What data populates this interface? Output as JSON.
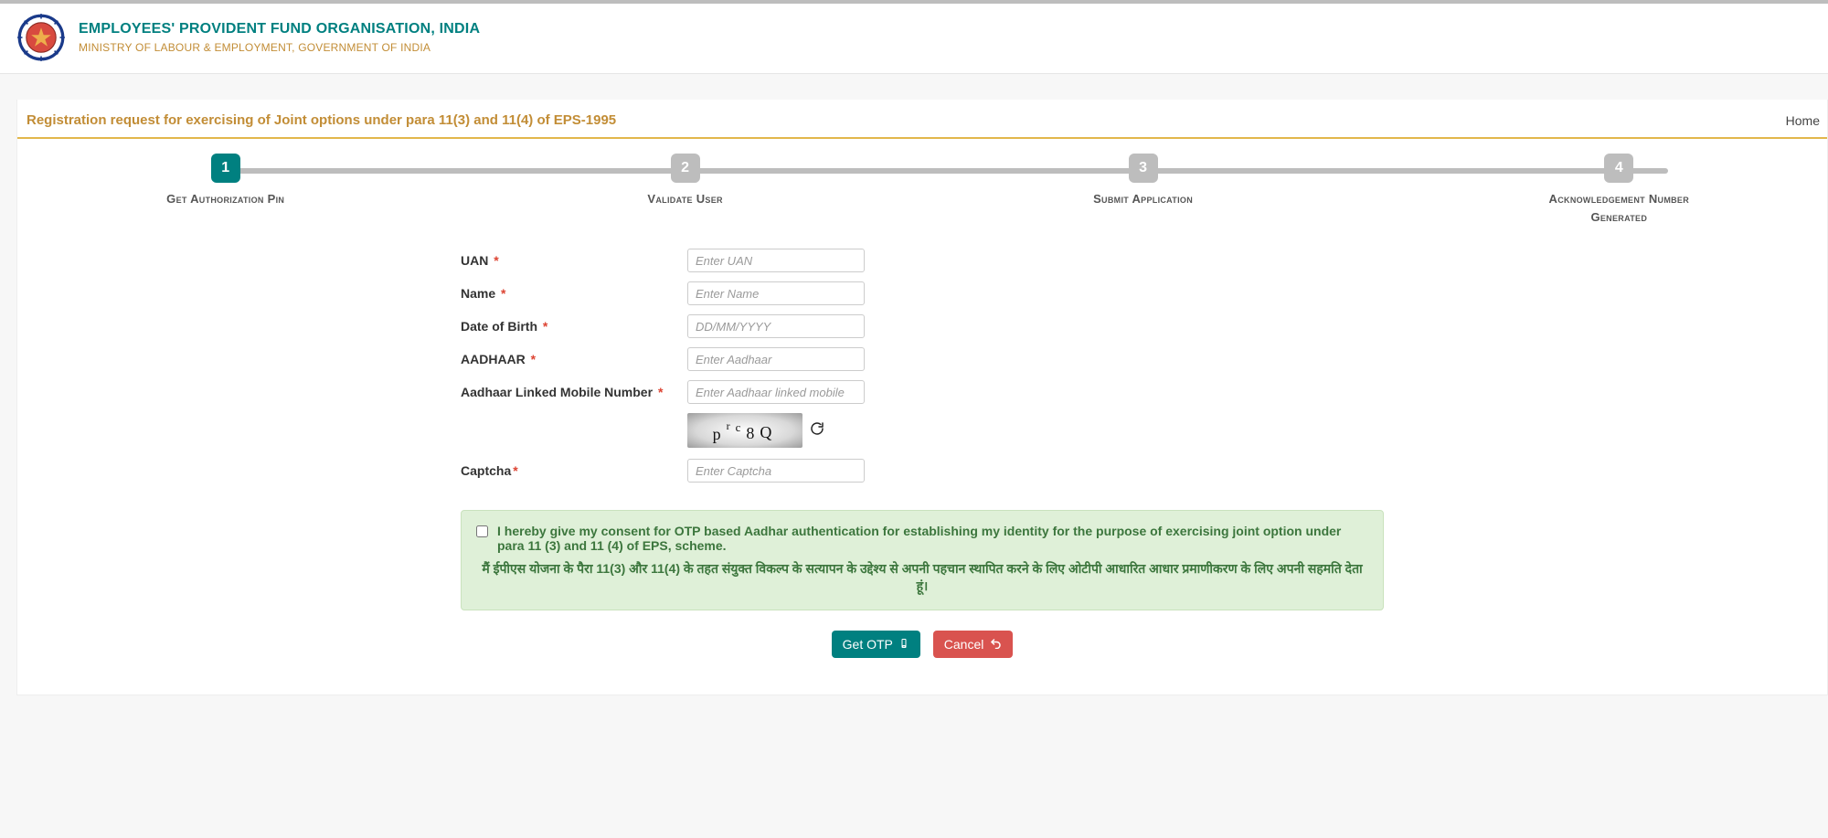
{
  "header": {
    "org_title": "EMPLOYEES' PROVIDENT FUND ORGANISATION, INDIA",
    "ministry": "MINISTRY OF LABOUR & EMPLOYMENT, GOVERNMENT OF INDIA"
  },
  "page": {
    "title": "Registration request for exercising of Joint options under para 11(3) and 11(4) of EPS-1995",
    "home_label": "Home"
  },
  "stepper": {
    "steps": [
      {
        "num": "1",
        "label": "Get Authorization Pin",
        "active": true
      },
      {
        "num": "2",
        "label": "Validate User",
        "active": false
      },
      {
        "num": "3",
        "label": "Submit Application",
        "active": false
      },
      {
        "num": "4",
        "label": "Acknowledgement Number Generated",
        "active": false
      }
    ]
  },
  "form": {
    "uan_label": "UAN",
    "uan_placeholder": "Enter UAN",
    "name_label": "Name",
    "name_placeholder": "Enter Name",
    "dob_label": "Date of Birth",
    "dob_placeholder": "DD/MM/YYYY",
    "aadhaar_label": "AADHAAR",
    "aadhaar_placeholder": "Enter Aadhaar",
    "mobile_label": "Aadhaar Linked Mobile Number",
    "mobile_placeholder": "Enter Aadhaar linked mobile",
    "captcha_label": "Captcha",
    "captcha_placeholder": "Enter Captcha",
    "captcha_value": "prc8Q"
  },
  "consent": {
    "text_en": "I hereby give my consent for OTP based Aadhar authentication for establishing my identity for the purpose of exercising joint option under para 11 (3) and 11 (4) of EPS, scheme.",
    "text_hi": "मैं ईपीएस योजना के पैरा 11(3) और 11(4) के तहत संयुक्त विकल्प के सत्यापन के उद्देश्य से अपनी पहचान स्थापित करने के लिए ओटीपी आधारित आधार प्रमाणीकरण के लिए अपनी सहमति देता हूं।"
  },
  "actions": {
    "get_otp": "Get OTP",
    "cancel": "Cancel"
  }
}
